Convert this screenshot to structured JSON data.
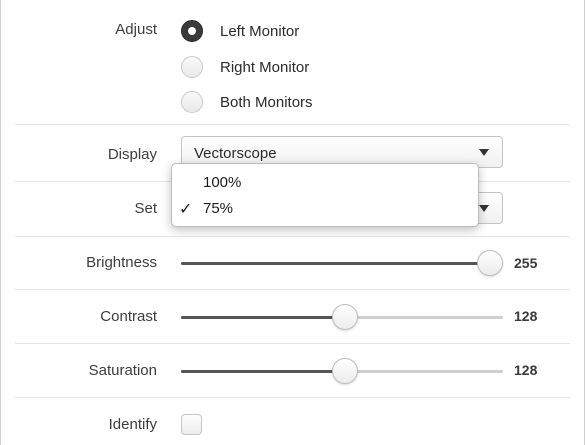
{
  "adjust": {
    "label": "Adjust",
    "options": [
      "Left Monitor",
      "Right Monitor",
      "Both Monitors"
    ],
    "selected": "Left Monitor"
  },
  "display": {
    "label": "Display",
    "value": "Vectorscope",
    "icon": "chevron-down-icon"
  },
  "set": {
    "label": "Set",
    "dropdown_options": [
      "100%",
      "75%"
    ],
    "selected": "75%",
    "check_glyph": "✓"
  },
  "brightness": {
    "label": "Brightness",
    "value": "255",
    "level": 1.0
  },
  "contrast": {
    "label": "Contrast",
    "value": "128",
    "level": 0.5
  },
  "saturation": {
    "label": "Saturation",
    "value": "128",
    "level": 0.5
  },
  "identify": {
    "label": "Identify",
    "checked": false
  },
  "colors": {
    "accent": "#3a3a3a",
    "track": "#cfcfcf",
    "fill": "#555555"
  }
}
